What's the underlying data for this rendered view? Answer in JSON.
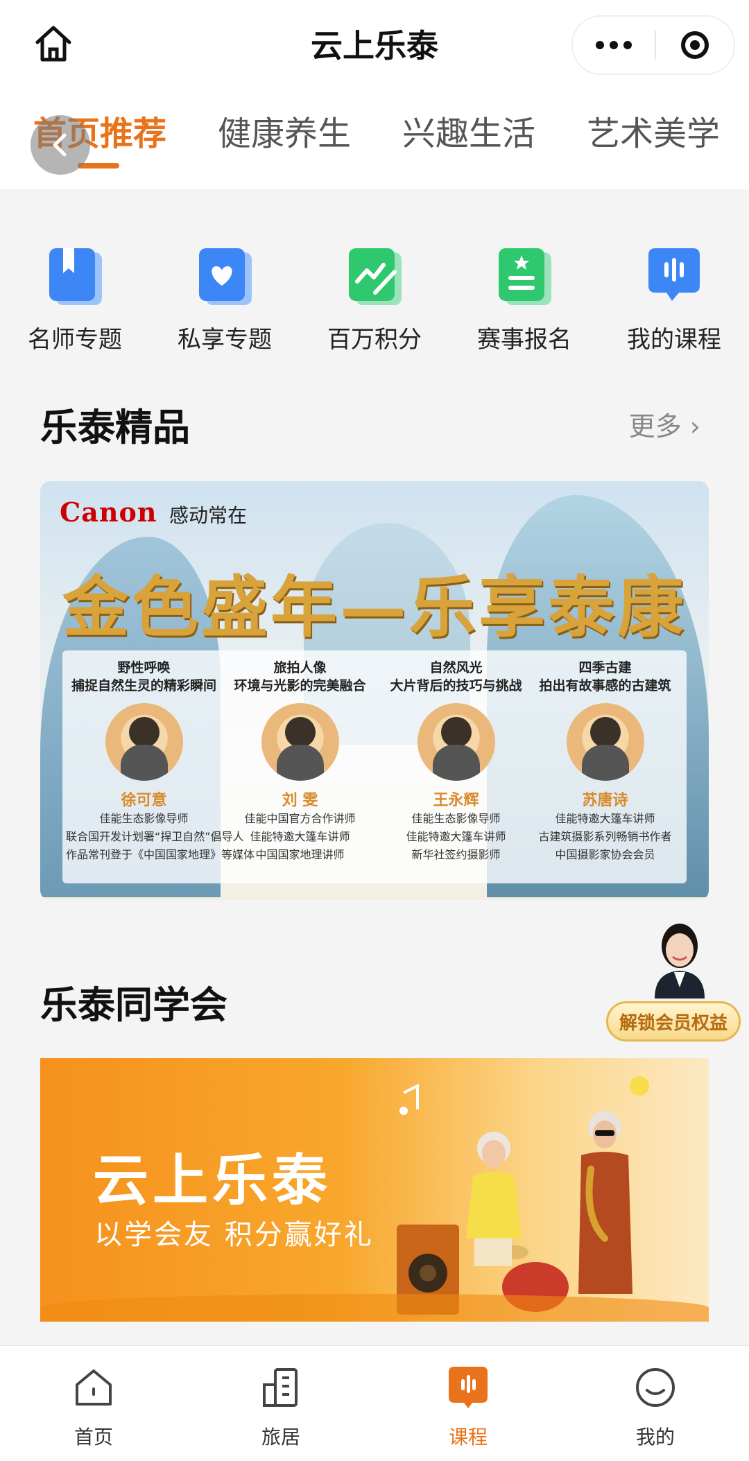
{
  "app": {
    "title": "云上乐泰"
  },
  "tabs": [
    {
      "label": "首页推荐",
      "active": true
    },
    {
      "label": "健康养生",
      "active": false
    },
    {
      "label": "兴趣生活",
      "active": false
    },
    {
      "label": "艺术美学",
      "active": false
    }
  ],
  "shortcuts": [
    {
      "label": "名师专题",
      "icon": "bookmark-book-icon",
      "color": "#3d86f5"
    },
    {
      "label": "私享专题",
      "icon": "heart-book-icon",
      "color": "#3d86f5"
    },
    {
      "label": "百万积分",
      "icon": "chart-pen-icon",
      "color": "#2fc86e"
    },
    {
      "label": "赛事报名",
      "icon": "star-list-icon",
      "color": "#2fc86e"
    },
    {
      "label": "我的课程",
      "icon": "audio-chat-icon",
      "color": "#3d86f5"
    }
  ],
  "section1": {
    "title": "乐泰精品",
    "more": "更多"
  },
  "banner1": {
    "brand": "Canon",
    "slogan": "感动常在",
    "headline": "金色盛年—乐享泰康",
    "mentors": [
      {
        "tagline1": "野性呼唤",
        "tagline2": "捕捉自然生灵的精彩瞬间",
        "name": "徐可意",
        "desc": [
          "佳能生态影像导师",
          "联合国开发计划署“捍卫自然”倡导人",
          "作品常刊登于《中国国家地理》等媒体"
        ]
      },
      {
        "tagline1": "旅拍人像",
        "tagline2": "环境与光影的完美融合",
        "name": "刘 雯",
        "desc": [
          "佳能中国官方合作讲师",
          "佳能特邀大篷车讲师",
          "中国国家地理讲师"
        ]
      },
      {
        "tagline1": "自然风光",
        "tagline2": "大片背后的技巧与挑战",
        "name": "王永辉",
        "desc": [
          "佳能生态影像导师",
          "佳能特邀大篷车讲师",
          "新华社签约摄影师"
        ]
      },
      {
        "tagline1": "四季古建",
        "tagline2": "拍出有故事感的古建筑",
        "name": "苏唐诗",
        "desc": [
          "佳能特邀大篷车讲师",
          "古建筑摄影系列畅销书作者",
          "中国摄影家协会会员"
        ]
      }
    ]
  },
  "section2": {
    "title": "乐泰同学会"
  },
  "member": {
    "button": "解锁会员权益"
  },
  "banner2": {
    "title": "云上乐泰",
    "subtitle": "以学会友 积分赢好礼"
  },
  "bottom_nav": [
    {
      "label": "首页",
      "icon": "home-icon",
      "active": false
    },
    {
      "label": "旅居",
      "icon": "building-icon",
      "active": false
    },
    {
      "label": "课程",
      "icon": "course-icon",
      "active": true
    },
    {
      "label": "我的",
      "icon": "smile-icon",
      "active": false
    }
  ],
  "colors": {
    "accent": "#e8731b",
    "blue": "#3d86f5",
    "green": "#2fc86e"
  }
}
